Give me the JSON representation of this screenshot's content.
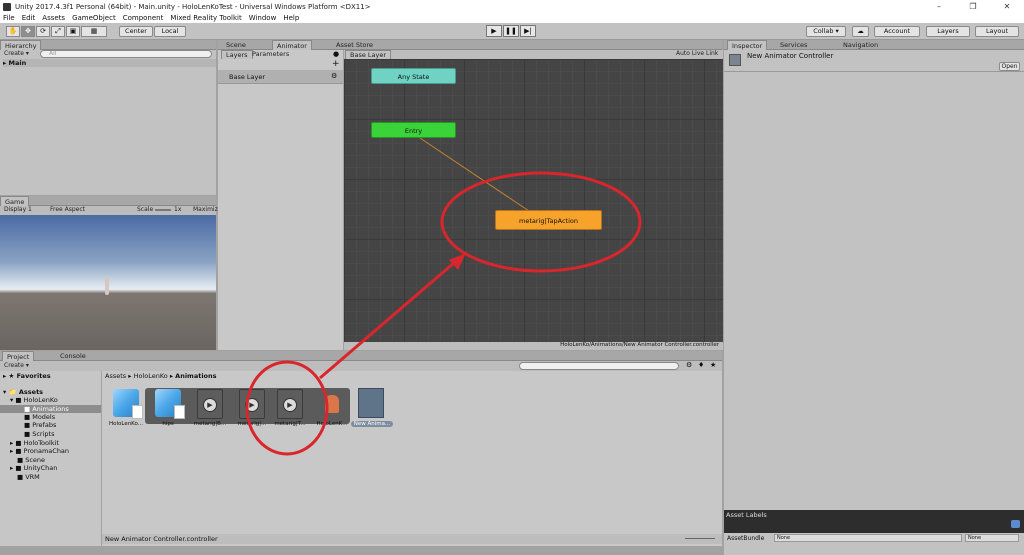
{
  "window": {
    "title": "Unity 2017.4.3f1 Personal (64bit) - Main.unity - HoloLenKoTest - Universal Windows Platform <DX11>"
  },
  "menu": [
    "File",
    "Edit",
    "Assets",
    "GameObject",
    "Component",
    "Mixed Reality Toolkit",
    "Window",
    "Help"
  ],
  "toolbar": {
    "center_label": "Center",
    "local_label": "Local",
    "collab_label": "Collab ▾",
    "account_label": "Account",
    "layers_label": "Layers",
    "layout_label": "Layout"
  },
  "hierarchy": {
    "tab": "Hierarchy",
    "create": "Create ▾",
    "search_placeholder": "All",
    "scene_item": "Main"
  },
  "game": {
    "tab": "Game",
    "display": "Display 1",
    "aspect": "Free Aspect",
    "scale_label": "Scale",
    "scale_value": "1x",
    "maximize": "Maximiz"
  },
  "center_tabs": {
    "scene": "Scene",
    "animator": "Animator",
    "asset_store": "Asset Store"
  },
  "animator": {
    "layers_tab": "Layers",
    "parameters_tab": "Parameters",
    "base_layer": "Base Layer",
    "breadcrumb": "Base Layer",
    "auto_live_link": "Auto Live Link",
    "states": {
      "any": "Any State",
      "entry": "Entry",
      "tap": "metarig|TapAction"
    },
    "path": "HoloLenKo/Animations/New Animator Controller.controller"
  },
  "inspector": {
    "tab": "Inspector",
    "services_tab": "Services",
    "navigation_tab": "Navigation",
    "object_name": "New Animator Controller",
    "open_button": "Open",
    "asset_labels": "Asset Labels",
    "asset_bundle_label": "AssetBundle",
    "none1": "None",
    "none2": "None"
  },
  "project": {
    "project_tab": "Project",
    "console_tab": "Console",
    "create": "Create ▾",
    "favorites": "Favorites",
    "assets_root": "Assets",
    "tree": [
      "HoloLenKo",
      "Animations",
      "Models",
      "Prefabs",
      "Scripts",
      "HoloToolkit",
      "PronamaChan",
      "Scene",
      "UnityChan",
      "VRM"
    ],
    "breadcrumb": [
      "Assets",
      "HoloLenKo",
      "Animations"
    ],
    "items": [
      "HoloLenKo...",
      "hips",
      "metarig|B...",
      "metarig|...",
      "metarig|T...",
      "HoloLenK...",
      "New Anima..."
    ],
    "footer": "New Animator Controller.controller"
  },
  "colors": {
    "any_state": "#6fd2c2",
    "entry": "#3ad43a",
    "tap_state": "#f7a22a",
    "annotation": "#d9262c"
  }
}
